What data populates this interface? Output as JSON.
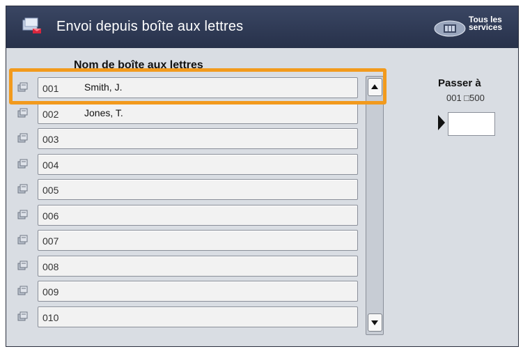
{
  "header": {
    "title": "Envoi depuis boîte aux lettres",
    "icon": "mailbox-send-icon",
    "services_label": "Tous les services",
    "services_icon": "grid-services-icon"
  },
  "list": {
    "column_label": "Nom de boîte aux lettres",
    "rows": [
      {
        "number": "001",
        "name": "Smith, J."
      },
      {
        "number": "002",
        "name": "Jones, T."
      },
      {
        "number": "003",
        "name": ""
      },
      {
        "number": "004",
        "name": ""
      },
      {
        "number": "005",
        "name": ""
      },
      {
        "number": "006",
        "name": ""
      },
      {
        "number": "007",
        "name": ""
      },
      {
        "number": "008",
        "name": ""
      },
      {
        "number": "009",
        "name": ""
      },
      {
        "number": "010",
        "name": ""
      }
    ],
    "selected_index": 0
  },
  "goto": {
    "label": "Passer à",
    "range": "001 □500",
    "value": ""
  },
  "colors": {
    "header": "#2f3a55",
    "highlight": "#f29a1d",
    "panel": "#d9dde3"
  }
}
